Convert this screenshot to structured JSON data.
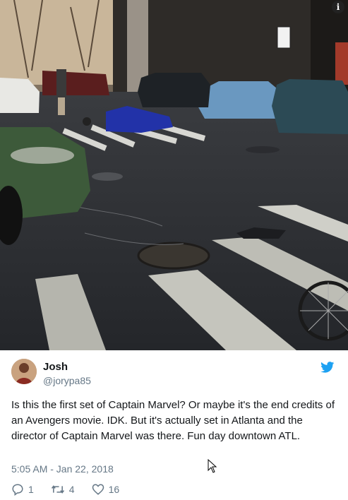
{
  "photo": {
    "description_icon": "info-icon",
    "alt": "Street scene with a crashed motorcycle, broken glass and bicycle wheel at a crosswalk in downtown Atlanta"
  },
  "info_label": "i",
  "tweet": {
    "author_name": "Josh",
    "author_handle": "@jorypa85",
    "text": "Is this the first set of Captain Marvel? Or maybe it's the end credits of an Avengers movie. IDK. But it's actually set in Atlanta and the director of Captain Marvel was there. Fun day downtown ATL.",
    "timestamp": "5:05 AM - Jan 22, 2018",
    "replies": "1",
    "retweets": "4",
    "likes": "16"
  },
  "colors": {
    "brand": "#1da1f2",
    "text": "#14171a",
    "muted": "#657786"
  },
  "icons": [
    "info-icon",
    "twitter-bird-icon",
    "reply-icon",
    "retweet-icon",
    "like-icon",
    "cursor-icon"
  ]
}
